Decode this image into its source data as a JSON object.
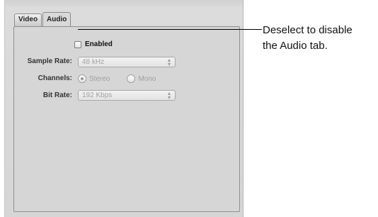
{
  "tabs": [
    {
      "label": "Video",
      "active": false
    },
    {
      "label": "Audio",
      "active": true
    }
  ],
  "enabled": {
    "label": "Enabled",
    "checked": false
  },
  "sample_rate": {
    "label": "Sample Rate:",
    "value": "48 kHz"
  },
  "channels": {
    "label": "Channels:",
    "options": [
      {
        "label": "Stereo",
        "selected": true
      },
      {
        "label": "Mono",
        "selected": false
      }
    ]
  },
  "bit_rate": {
    "label": "Bit Rate:",
    "value": "192 Kbps"
  },
  "callout": {
    "line1": "Deselect to disable",
    "line2": "the Audio tab."
  },
  "icons": {
    "popup_arrows": "up-down-arrows-icon"
  }
}
